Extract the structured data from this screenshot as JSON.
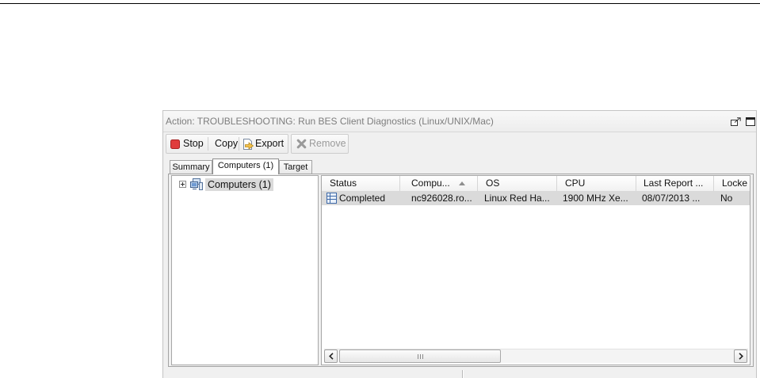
{
  "window": {
    "title": "Action: TROUBLESHOOTING: Run BES Client Diagnostics (Linux/UNIX/Mac)",
    "controls": [
      {
        "icon": "detach-icon"
      },
      {
        "icon": "maximize-icon"
      }
    ]
  },
  "toolbar": {
    "stop": {
      "label": "Stop",
      "icon": "stop-icon",
      "enabled": true
    },
    "copy": {
      "label": "Copy",
      "enabled": true
    },
    "export": {
      "label": "Export",
      "icon": "export-icon",
      "enabled": true
    },
    "remove": {
      "label": "Remove",
      "icon": "remove-icon",
      "enabled": false
    }
  },
  "tabs": [
    {
      "label": "Summary",
      "selected": false
    },
    {
      "label": "Computers (1)",
      "selected": true
    },
    {
      "label": "Target",
      "selected": false
    }
  ],
  "tree": {
    "items": [
      {
        "label": "Computers (1)",
        "icon": "computers-group-icon",
        "expanded": false,
        "selected": true
      }
    ]
  },
  "table": {
    "columns": [
      {
        "label": "Status"
      },
      {
        "label": "Compu...",
        "sort_icon": "sort-ascending-icon"
      },
      {
        "label": "OS"
      },
      {
        "label": "CPU"
      },
      {
        "label": "Last Report ..."
      },
      {
        "label": "Locke"
      }
    ],
    "rows": [
      {
        "status": "Completed",
        "status_icon": "status-completed-icon",
        "computer": "nc926028.ro...",
        "os": "Linux Red Ha...",
        "cpu": "1900 MHz Xe...",
        "last_report": "08/07/2013 ...",
        "locked": "No",
        "selected": true
      }
    ]
  },
  "scrollbars": {
    "horizontal": {
      "position": 0,
      "visible_fraction": 0.41
    }
  },
  "colors": {
    "stop": "#e03c3c",
    "selection": "#dadada",
    "window_background": "#f0f0f0",
    "title_text": "#7d7d7d",
    "disabled_text": "#9a9a9a"
  }
}
